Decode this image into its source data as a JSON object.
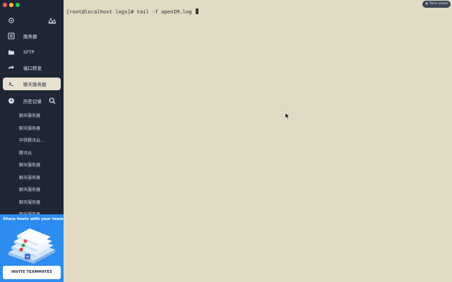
{
  "sidebar": {
    "nav": [
      {
        "label": "服务器",
        "icon": "server-icon"
      },
      {
        "label": "SFTP",
        "icon": "folder-icon"
      },
      {
        "label": "端口转发",
        "icon": "arrow-forward-icon"
      },
      {
        "label": "聊天服务器",
        "icon": "terminal-icon",
        "active": true
      }
    ],
    "history_label": "历史记录",
    "history": [
      "聊天服务器",
      "聊天服务器",
      "中铁腾讯云...",
      "腾讯云",
      "聊天服务器",
      "聊天服务器",
      "聊天服务器",
      "聊天服务器",
      "聊天服务器"
    ]
  },
  "promo": {
    "title": "Share hosts with your team",
    "button": "INVITE TEAMMATES"
  },
  "terminal": {
    "line": "[root@localhost logs]# tail -f openIM.log ",
    "badge": "Pairs needs"
  },
  "colors": {
    "sidebar_bg": "#1f2736",
    "terminal_bg": "#e0d9c4",
    "promo_bg": "#2d8cf0",
    "active_item_bg": "#e7e1cf"
  }
}
